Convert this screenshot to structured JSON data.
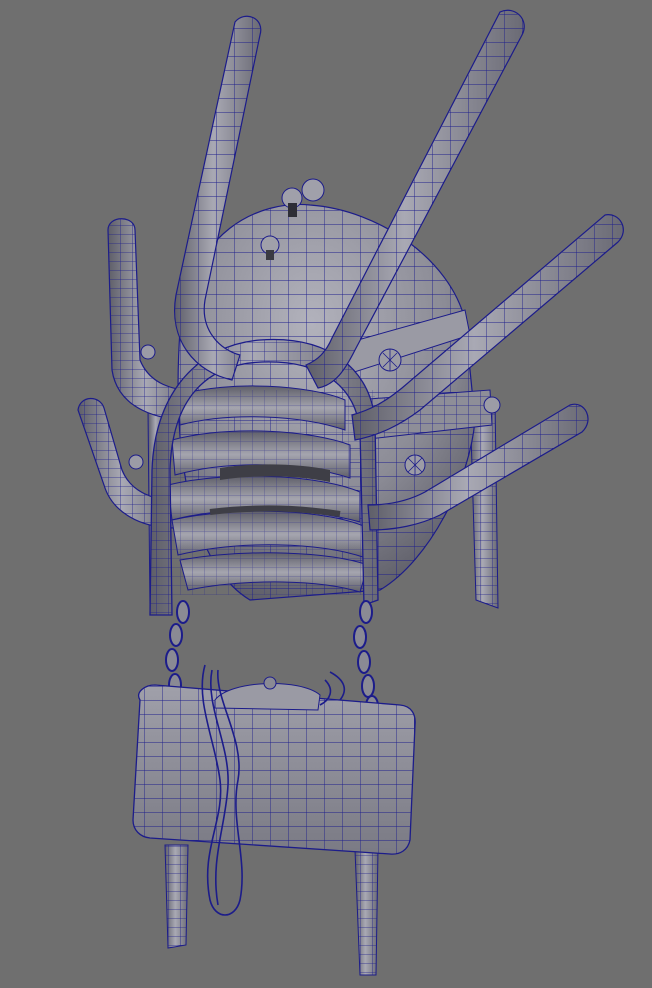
{
  "viewport": {
    "background": "#6f6f6f",
    "wire_color": "#1c1c8a",
    "shade_light": "#a9a9b3",
    "shade_mid": "#8e8e98",
    "shade_dark": "#5c5c66",
    "display_mode": "wireframe-on-shaded"
  },
  "model": {
    "parts": [
      "helmet-dome",
      "face-cage-bars",
      "spike-tubes",
      "face-frame-arch",
      "side-straps",
      "chains",
      "box-pack",
      "wires",
      "pack-straps",
      "bolts"
    ]
  }
}
